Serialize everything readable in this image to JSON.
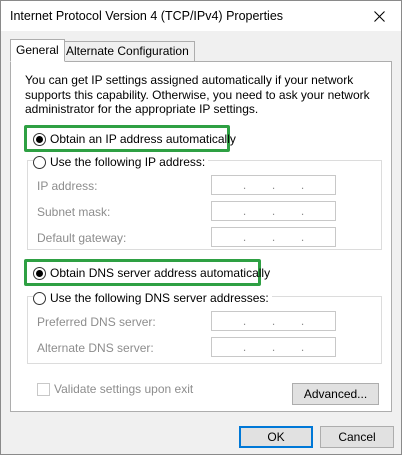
{
  "window": {
    "title": "Internet Protocol Version 4 (TCP/IPv4) Properties",
    "close_icon": "close-icon"
  },
  "tabs": [
    {
      "label": "General",
      "active": true
    },
    {
      "label": "Alternate Configuration",
      "active": false
    }
  ],
  "general": {
    "description": "You can get IP settings assigned automatically if your network supports this capability. Otherwise, you need to ask your network administrator for the appropriate IP settings.",
    "ip_auto_label": "Obtain an IP address automatically",
    "ip_manual_label": "Use the following IP address:",
    "ip_auto_selected": true,
    "ip_fields": [
      {
        "label": "IP address:",
        "value": ". . ."
      },
      {
        "label": "Subnet mask:",
        "value": ". . ."
      },
      {
        "label": "Default gateway:",
        "value": ". . ."
      }
    ],
    "dns_auto_label": "Obtain DNS server address automatically",
    "dns_manual_label": "Use the following DNS server addresses:",
    "dns_auto_selected": true,
    "dns_fields": [
      {
        "label": "Preferred DNS server:",
        "value": ". . ."
      },
      {
        "label": "Alternate DNS server:",
        "value": ". . ."
      }
    ],
    "validate_label": "Validate settings upon exit",
    "validate_checked": false,
    "advanced_label": "Advanced..."
  },
  "buttons": {
    "ok": "OK",
    "cancel": "Cancel"
  },
  "colors": {
    "highlight": "#2ea043",
    "default_button_border": "#0078d7",
    "disabled_text": "#8d8d8d"
  }
}
